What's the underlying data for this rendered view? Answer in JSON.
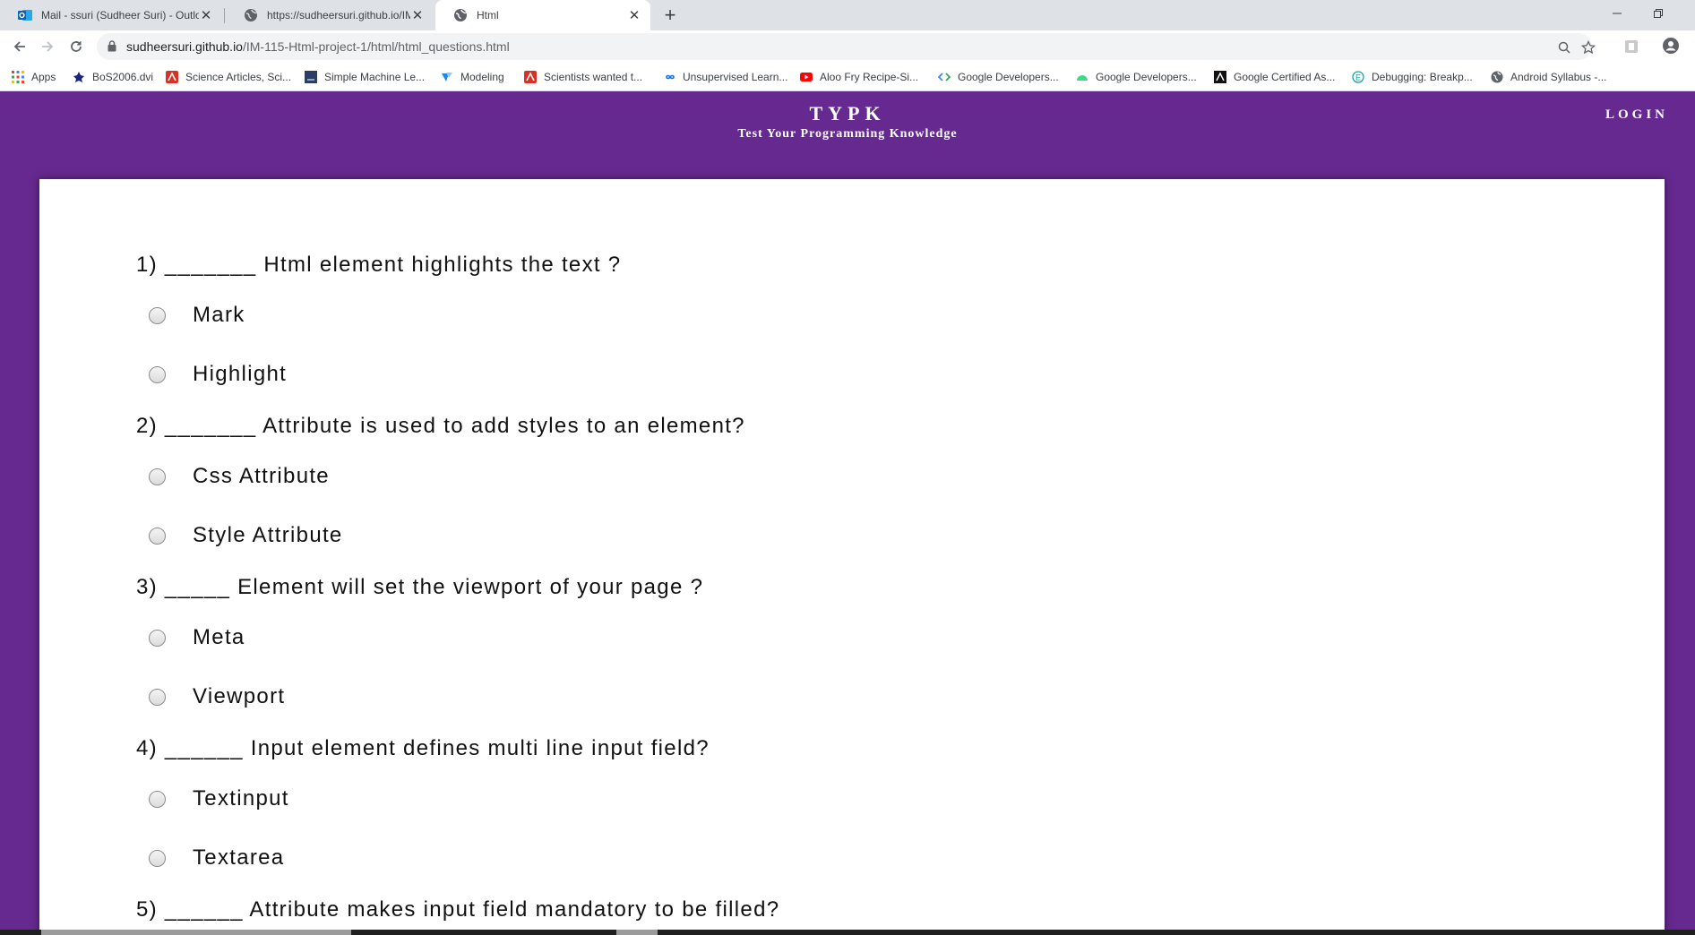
{
  "browser": {
    "tabs": [
      {
        "title": "Mail - ssuri (Sudheer Suri) - Outlook",
        "favicon": "outlook-icon"
      },
      {
        "title": "https://sudheersuri.github.io/IM-115-Html-project-1/",
        "favicon": "globe-icon"
      },
      {
        "title": "Html",
        "favicon": "globe-icon"
      }
    ],
    "url_host": "sudheersuri.github.io",
    "url_path": "/IM-115-Html-project-1/html/html_questions.html",
    "bookmarks": [
      {
        "label": "Apps",
        "icon": "apps-grid-icon"
      },
      {
        "label": "BoS2006.dvi",
        "icon": "dvi-icon"
      },
      {
        "label": "Science Articles, Sci...",
        "icon": "science-icon"
      },
      {
        "label": "Simple Machine Le...",
        "icon": "page-icon"
      },
      {
        "label": "Modeling",
        "icon": "modeling-icon"
      },
      {
        "label": "Scientists wanted t...",
        "icon": "science-icon"
      },
      {
        "label": "Unsupervised Learn...",
        "icon": "infinity-icon"
      },
      {
        "label": "Aloo Fry Recipe-Si...",
        "icon": "youtube-icon"
      },
      {
        "label": "Google Developers...",
        "icon": "code-icon"
      },
      {
        "label": "Google Developers...",
        "icon": "android-icon"
      },
      {
        "label": "Google Certified As...",
        "icon": "cert-icon"
      },
      {
        "label": "Debugging: Breakp...",
        "icon": "e-icon"
      },
      {
        "label": "Android Syllabus -...",
        "icon": "globe-icon"
      }
    ]
  },
  "site": {
    "logo": "TYPK",
    "tagline": "Test Your Programming Knowledge",
    "login": "LOGIN"
  },
  "questions": [
    {
      "text": "1) _______ Html element highlights the text ?",
      "options": [
        "Mark",
        "Highlight"
      ]
    },
    {
      "text": "2) _______ Attribute is used to add styles to an element?",
      "options": [
        "Css Attribute",
        "Style Attribute"
      ]
    },
    {
      "text": "3) _____ Element will set the viewport of your page ?",
      "options": [
        "Meta",
        "Viewport"
      ]
    },
    {
      "text": "4) ______ Input element defines multi line input field?",
      "options": [
        "Textinput",
        "Textarea"
      ]
    },
    {
      "text": "5) ______ Attribute makes input field mandatory to be filled?",
      "options": []
    }
  ]
}
